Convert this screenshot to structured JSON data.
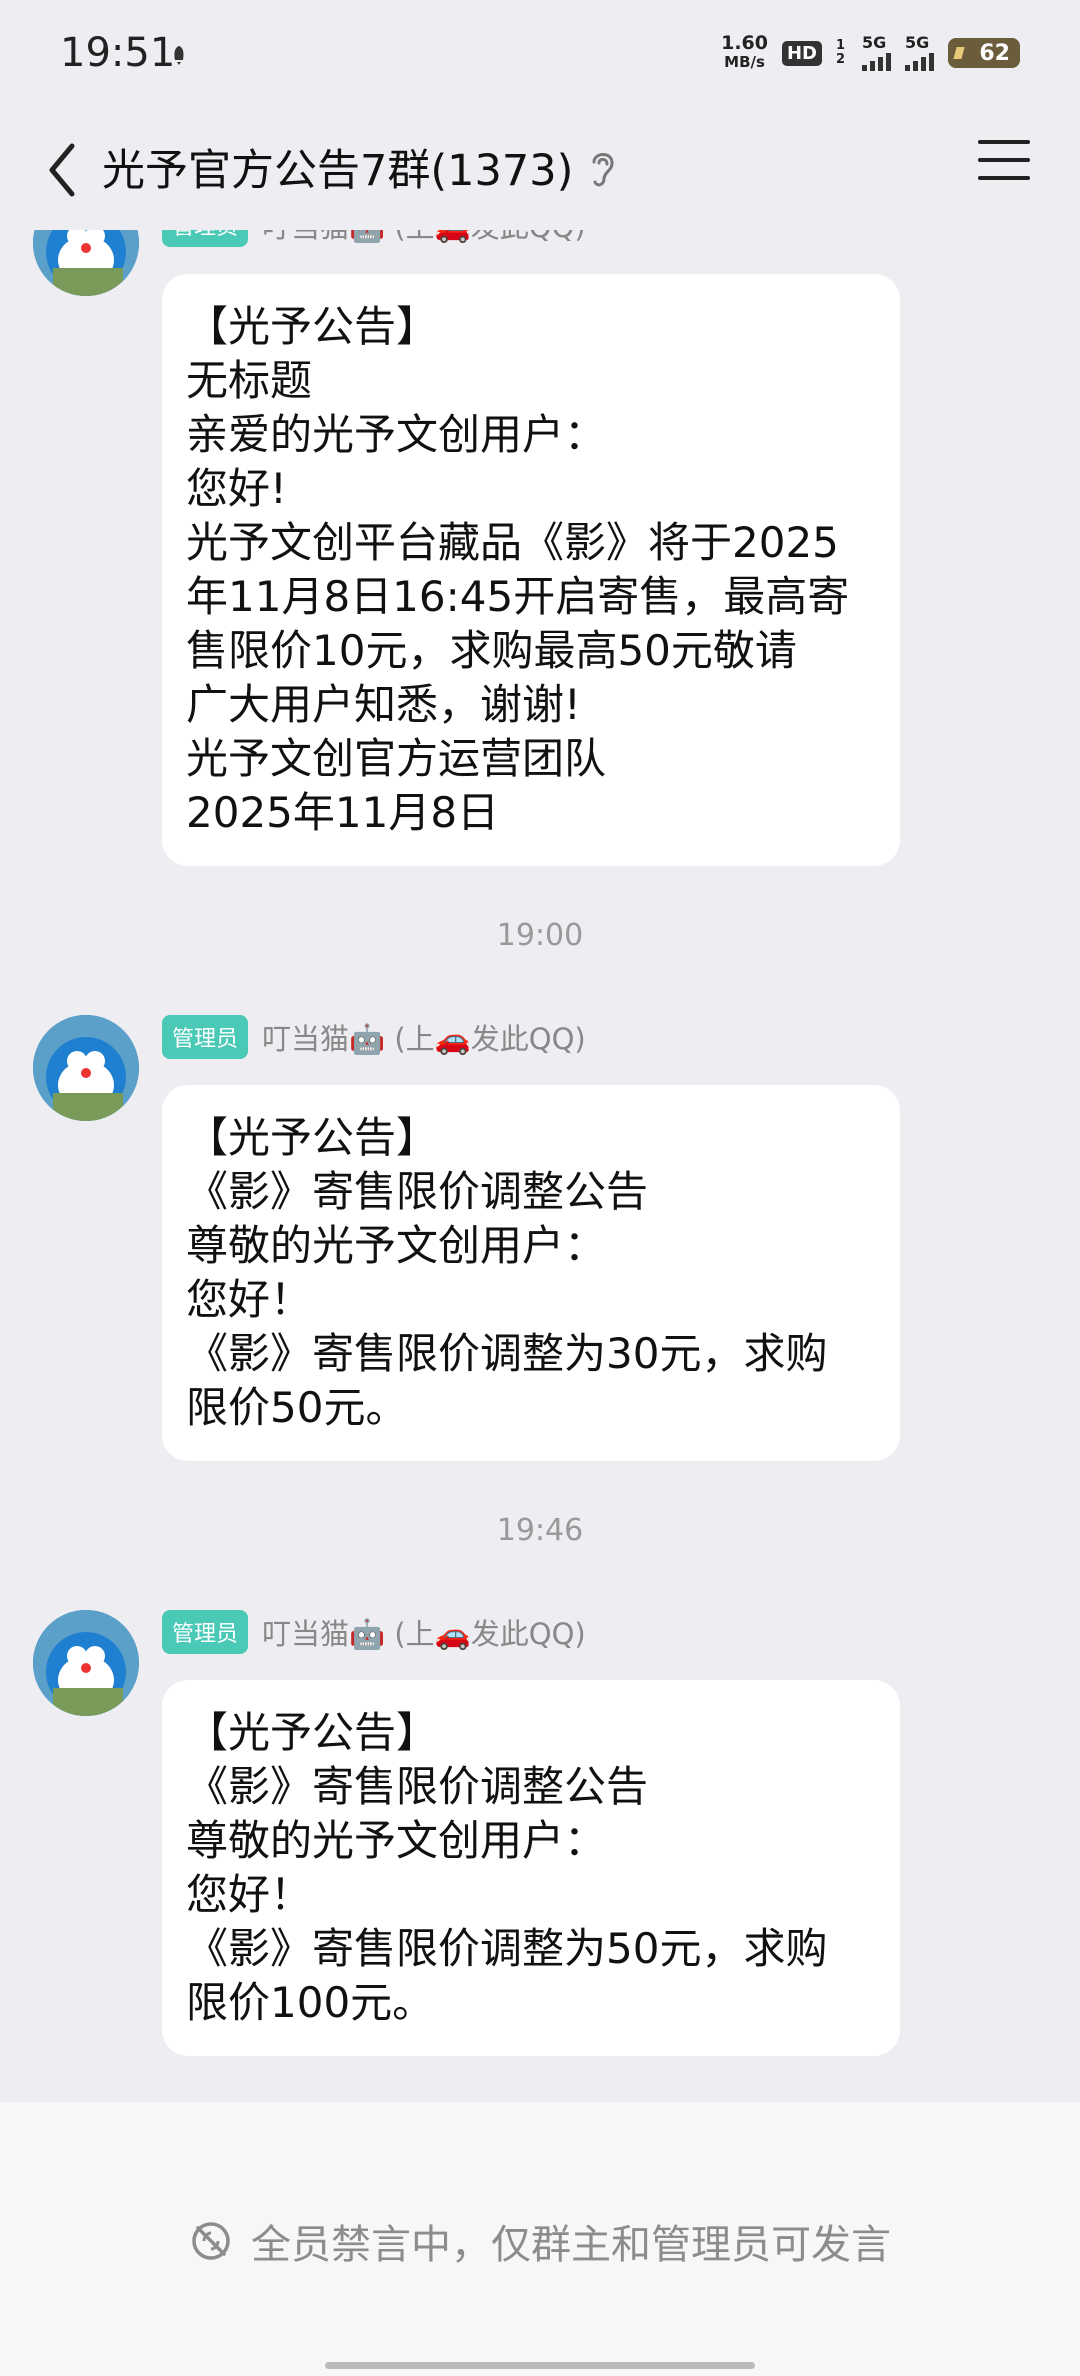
{
  "status_bar": {
    "time": "19:51",
    "net_speed_value": "1.60",
    "net_speed_unit": "MB/s",
    "hd_label": "HD",
    "sim1_label": "5G",
    "sim2_label": "5G",
    "sim_numbers": "1 2",
    "battery": "62"
  },
  "header": {
    "title": "光予官方公告7群(1373)"
  },
  "messages": [
    {
      "badge": "管理员",
      "sender": "叮当猫🤖 (上🚗发此QQ)",
      "lines": [
        "【光予公告】",
        "无标题",
        "亲爱的光予文创用户：",
        "您好!",
        "光予文创平台藏品《影》将于2025",
        "年11月8日16:45开启寄售，最高寄",
        "售限价10元，求购最高50元敬请",
        "广大用户知悉，谢谢!",
        "光予文创官方运营团队",
        "2025年11月8日"
      ]
    },
    {
      "time": "19:00",
      "badge": "管理员",
      "sender": "叮当猫🤖 (上🚗发此QQ)",
      "lines": [
        "【光予公告】",
        "《影》寄售限价调整公告",
        "尊敬的光予文创用户：",
        "您好！",
        "《影》寄售限价调整为30元，求购",
        "限价50元。"
      ]
    },
    {
      "time": "19:46",
      "badge": "管理员",
      "sender": "叮当猫🤖 (上🚗发此QQ)",
      "lines": [
        "【光予公告】",
        "《影》寄售限价调整公告",
        "尊敬的光予文创用户：",
        "您好！",
        "《影》寄售限价调整为50元，求购",
        "限价100元。"
      ]
    }
  ],
  "footer": {
    "mute_notice": "全员禁言中，仅群主和管理员可发言"
  },
  "icons": {
    "back": "back-arrow-icon",
    "ear": "ear-icon",
    "menu": "menu-icon",
    "mute": "mute-icon",
    "avatar": "doraemon-avatar"
  },
  "colors": {
    "background": "#eeeef2",
    "bubble": "#ffffff",
    "badge": "#49c9b6",
    "footer": "#f7f7f9"
  }
}
